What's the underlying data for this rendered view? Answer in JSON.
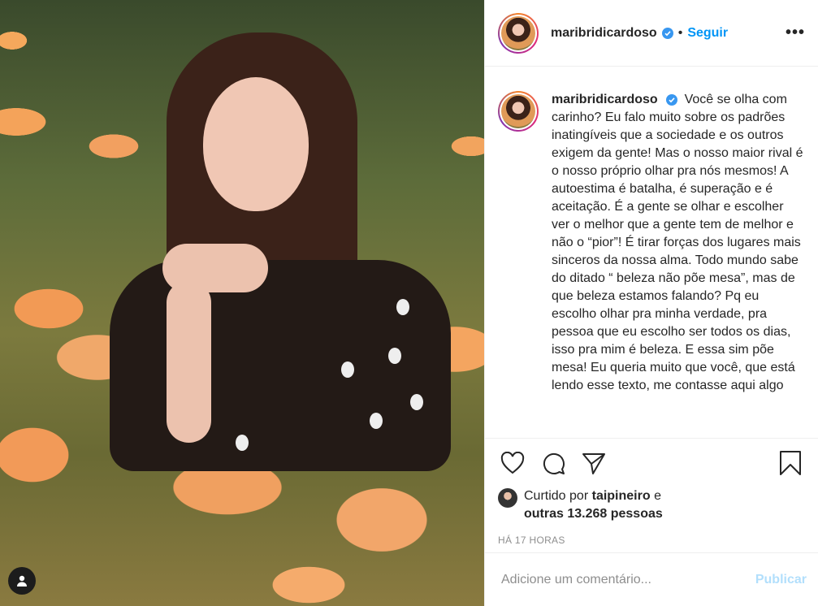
{
  "post": {
    "username": "maribridicardoso",
    "separator": "•",
    "follow_label": "Seguir",
    "more_icon": "more-options-icon",
    "caption": "Você se olha com carinho? Eu falo muito sobre os padrões inatingíveis que a sociedade e os outros exigem da gente! Mas o nosso maior rival é o nosso próprio olhar pra nós mesmos! A autoestima é batalha, é superação e é aceitação. É a gente se olhar e escolher ver o melhor que a gente tem de melhor e não o “pior”! É tirar forças dos lugares mais sinceros da nossa alma. Todo mundo sabe do ditado “ beleza não põe mesa”, mas de que beleza estamos falando? Pq eu escolho olhar pra minha verdade, pra pessoa que eu escolho ser todos os dias, isso pra mim é beleza. E essa sim põe mesa! Eu queria muito que você, que está lendo esse texto, me contasse aqui algo",
    "likes_prefix": "Curtido por",
    "likes_user": "taipineiro",
    "likes_and": "e",
    "likes_others": "outras 13.268 pessoas",
    "timestamp": "HÁ 17 HORAS"
  },
  "comment": {
    "placeholder": "Adicione um comentário...",
    "publish_label": "Publicar"
  },
  "colors": {
    "accent": "#0095f6",
    "verified": "#3897f0",
    "publish_disabled": "#b2dffc"
  }
}
